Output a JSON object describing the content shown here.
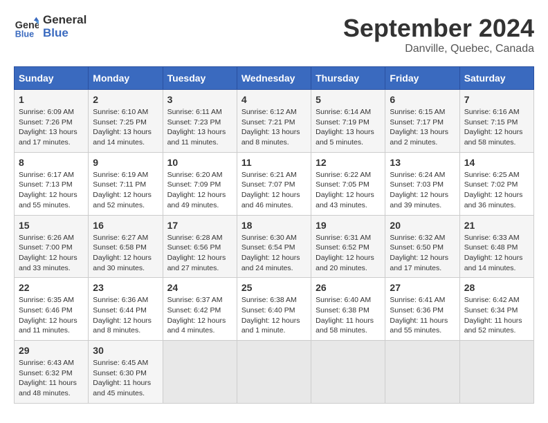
{
  "header": {
    "logo_line1": "General",
    "logo_line2": "Blue",
    "month_title": "September 2024",
    "location": "Danville, Quebec, Canada"
  },
  "days_of_week": [
    "Sunday",
    "Monday",
    "Tuesday",
    "Wednesday",
    "Thursday",
    "Friday",
    "Saturday"
  ],
  "weeks": [
    [
      {
        "num": "1",
        "sunrise": "Sunrise: 6:09 AM",
        "sunset": "Sunset: 7:26 PM",
        "daylight": "Daylight: 13 hours and 17 minutes."
      },
      {
        "num": "2",
        "sunrise": "Sunrise: 6:10 AM",
        "sunset": "Sunset: 7:25 PM",
        "daylight": "Daylight: 13 hours and 14 minutes."
      },
      {
        "num": "3",
        "sunrise": "Sunrise: 6:11 AM",
        "sunset": "Sunset: 7:23 PM",
        "daylight": "Daylight: 13 hours and 11 minutes."
      },
      {
        "num": "4",
        "sunrise": "Sunrise: 6:12 AM",
        "sunset": "Sunset: 7:21 PM",
        "daylight": "Daylight: 13 hours and 8 minutes."
      },
      {
        "num": "5",
        "sunrise": "Sunrise: 6:14 AM",
        "sunset": "Sunset: 7:19 PM",
        "daylight": "Daylight: 13 hours and 5 minutes."
      },
      {
        "num": "6",
        "sunrise": "Sunrise: 6:15 AM",
        "sunset": "Sunset: 7:17 PM",
        "daylight": "Daylight: 13 hours and 2 minutes."
      },
      {
        "num": "7",
        "sunrise": "Sunrise: 6:16 AM",
        "sunset": "Sunset: 7:15 PM",
        "daylight": "Daylight: 12 hours and 58 minutes."
      }
    ],
    [
      {
        "num": "8",
        "sunrise": "Sunrise: 6:17 AM",
        "sunset": "Sunset: 7:13 PM",
        "daylight": "Daylight: 12 hours and 55 minutes."
      },
      {
        "num": "9",
        "sunrise": "Sunrise: 6:19 AM",
        "sunset": "Sunset: 7:11 PM",
        "daylight": "Daylight: 12 hours and 52 minutes."
      },
      {
        "num": "10",
        "sunrise": "Sunrise: 6:20 AM",
        "sunset": "Sunset: 7:09 PM",
        "daylight": "Daylight: 12 hours and 49 minutes."
      },
      {
        "num": "11",
        "sunrise": "Sunrise: 6:21 AM",
        "sunset": "Sunset: 7:07 PM",
        "daylight": "Daylight: 12 hours and 46 minutes."
      },
      {
        "num": "12",
        "sunrise": "Sunrise: 6:22 AM",
        "sunset": "Sunset: 7:05 PM",
        "daylight": "Daylight: 12 hours and 43 minutes."
      },
      {
        "num": "13",
        "sunrise": "Sunrise: 6:24 AM",
        "sunset": "Sunset: 7:03 PM",
        "daylight": "Daylight: 12 hours and 39 minutes."
      },
      {
        "num": "14",
        "sunrise": "Sunrise: 6:25 AM",
        "sunset": "Sunset: 7:02 PM",
        "daylight": "Daylight: 12 hours and 36 minutes."
      }
    ],
    [
      {
        "num": "15",
        "sunrise": "Sunrise: 6:26 AM",
        "sunset": "Sunset: 7:00 PM",
        "daylight": "Daylight: 12 hours and 33 minutes."
      },
      {
        "num": "16",
        "sunrise": "Sunrise: 6:27 AM",
        "sunset": "Sunset: 6:58 PM",
        "daylight": "Daylight: 12 hours and 30 minutes."
      },
      {
        "num": "17",
        "sunrise": "Sunrise: 6:28 AM",
        "sunset": "Sunset: 6:56 PM",
        "daylight": "Daylight: 12 hours and 27 minutes."
      },
      {
        "num": "18",
        "sunrise": "Sunrise: 6:30 AM",
        "sunset": "Sunset: 6:54 PM",
        "daylight": "Daylight: 12 hours and 24 minutes."
      },
      {
        "num": "19",
        "sunrise": "Sunrise: 6:31 AM",
        "sunset": "Sunset: 6:52 PM",
        "daylight": "Daylight: 12 hours and 20 minutes."
      },
      {
        "num": "20",
        "sunrise": "Sunrise: 6:32 AM",
        "sunset": "Sunset: 6:50 PM",
        "daylight": "Daylight: 12 hours and 17 minutes."
      },
      {
        "num": "21",
        "sunrise": "Sunrise: 6:33 AM",
        "sunset": "Sunset: 6:48 PM",
        "daylight": "Daylight: 12 hours and 14 minutes."
      }
    ],
    [
      {
        "num": "22",
        "sunrise": "Sunrise: 6:35 AM",
        "sunset": "Sunset: 6:46 PM",
        "daylight": "Daylight: 12 hours and 11 minutes."
      },
      {
        "num": "23",
        "sunrise": "Sunrise: 6:36 AM",
        "sunset": "Sunset: 6:44 PM",
        "daylight": "Daylight: 12 hours and 8 minutes."
      },
      {
        "num": "24",
        "sunrise": "Sunrise: 6:37 AM",
        "sunset": "Sunset: 6:42 PM",
        "daylight": "Daylight: 12 hours and 4 minutes."
      },
      {
        "num": "25",
        "sunrise": "Sunrise: 6:38 AM",
        "sunset": "Sunset: 6:40 PM",
        "daylight": "Daylight: 12 hours and 1 minute."
      },
      {
        "num": "26",
        "sunrise": "Sunrise: 6:40 AM",
        "sunset": "Sunset: 6:38 PM",
        "daylight": "Daylight: 11 hours and 58 minutes."
      },
      {
        "num": "27",
        "sunrise": "Sunrise: 6:41 AM",
        "sunset": "Sunset: 6:36 PM",
        "daylight": "Daylight: 11 hours and 55 minutes."
      },
      {
        "num": "28",
        "sunrise": "Sunrise: 6:42 AM",
        "sunset": "Sunset: 6:34 PM",
        "daylight": "Daylight: 11 hours and 52 minutes."
      }
    ],
    [
      {
        "num": "29",
        "sunrise": "Sunrise: 6:43 AM",
        "sunset": "Sunset: 6:32 PM",
        "daylight": "Daylight: 11 hours and 48 minutes."
      },
      {
        "num": "30",
        "sunrise": "Sunrise: 6:45 AM",
        "sunset": "Sunset: 6:30 PM",
        "daylight": "Daylight: 11 hours and 45 minutes."
      },
      {
        "num": "",
        "sunrise": "",
        "sunset": "",
        "daylight": ""
      },
      {
        "num": "",
        "sunrise": "",
        "sunset": "",
        "daylight": ""
      },
      {
        "num": "",
        "sunrise": "",
        "sunset": "",
        "daylight": ""
      },
      {
        "num": "",
        "sunrise": "",
        "sunset": "",
        "daylight": ""
      },
      {
        "num": "",
        "sunrise": "",
        "sunset": "",
        "daylight": ""
      }
    ]
  ]
}
